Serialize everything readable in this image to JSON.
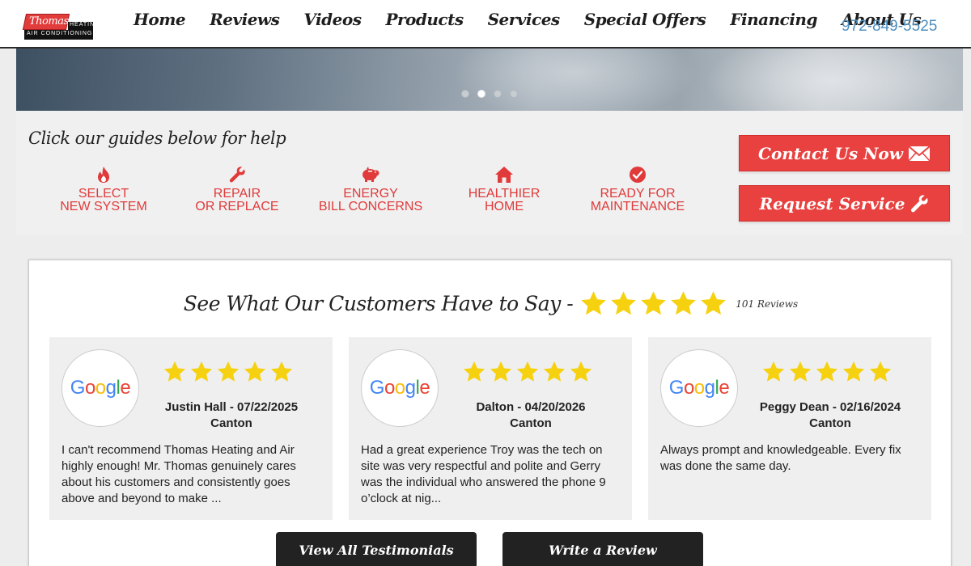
{
  "brand": {
    "logo_name": "Thomas",
    "logo_line1": "HEATING",
    "logo_line2": "AIR CONDITIONING",
    "colors": {
      "red": "#e8413f",
      "dark": "#222222",
      "phone": "#4f8fbf"
    }
  },
  "nav": {
    "items": [
      "Home",
      "Reviews",
      "Videos",
      "Products",
      "Services",
      "Special Offers",
      "Financing",
      "About Us"
    ],
    "phone": "972-849-5525"
  },
  "hero": {
    "slides": 4,
    "active_slide": 2
  },
  "guides": {
    "title": "Click our guides below for help",
    "items": [
      {
        "icon": "flame-icon",
        "line1": "SELECT",
        "line2": "NEW SYSTEM"
      },
      {
        "icon": "wrench-icon",
        "line1": "REPAIR",
        "line2": "OR REPLACE"
      },
      {
        "icon": "piggy-bank-icon",
        "line1": "ENERGY",
        "line2": "BILL CONCERNS"
      },
      {
        "icon": "house-icon",
        "line1": "HEALTHIER",
        "line2": "HOME"
      },
      {
        "icon": "check-circle-icon",
        "line1": "READY FOR",
        "line2": "MAINTENANCE"
      }
    ],
    "contact_label": "Contact Us Now",
    "request_label": "Request Service"
  },
  "reviews": {
    "title": "See What Our Customers Have to Say -",
    "rating": 5,
    "count": "101 Reviews",
    "cards": [
      {
        "source": "Google",
        "stars": 5,
        "name": "Justin Hall - 07/22/2025",
        "city": "Canton",
        "text": "I can't recommend Thomas Heating and Air highly enough! Mr. Thomas genuinely cares about his customers and consistently goes above and beyond to make ..."
      },
      {
        "source": "Google",
        "stars": 5,
        "name": "Dalton - 04/20/2026",
        "city": "Canton",
        "text": "Had a great experience Troy was the tech on site was very respectful and polite and Gerry was the individual who answered the phone 9 o’clock at nig..."
      },
      {
        "source": "Google",
        "stars": 5,
        "name": "Peggy Dean - 02/16/2024",
        "city": "Canton",
        "text": "Always prompt and knowledgeable. Every fix was done the same day."
      }
    ],
    "view_all_label": "View All Testimonials",
    "write_label": "Write a Review"
  }
}
